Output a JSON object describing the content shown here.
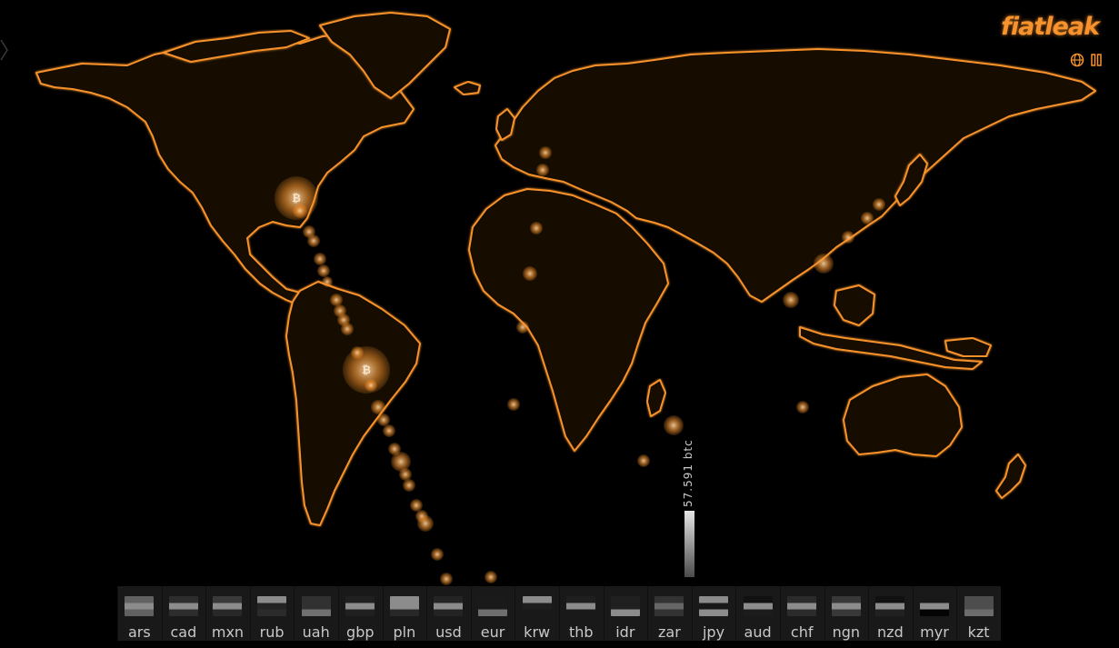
{
  "app": {
    "logo_text": "fiatleak"
  },
  "controls": {
    "globe_icon": "globe-icon",
    "pause_icon": "pause-icon"
  },
  "scale": {
    "value_label": "57.591 btc"
  },
  "currencies": [
    {
      "code": "ars",
      "flag": [
        "#8ab7dd",
        "#ffffff",
        "#8ab7dd"
      ]
    },
    {
      "code": "cad",
      "flag": [
        "#d32f2f",
        "#ffffff",
        "#d32f2f"
      ]
    },
    {
      "code": "mxn",
      "flag": [
        "#2e7d32",
        "#ffffff",
        "#c62828"
      ]
    },
    {
      "code": "rub",
      "flag": [
        "#ffffff",
        "#1e40a5",
        "#d52b1e"
      ]
    },
    {
      "code": "uah",
      "flag": [
        "#1f5fbf",
        "#1f5fbf",
        "#f2d600"
      ]
    },
    {
      "code": "gbp",
      "flag": [
        "#203a8f",
        "#ffffff",
        "#c8102e"
      ]
    },
    {
      "code": "pln",
      "flag": [
        "#ffffff",
        "#ffffff",
        "#d4213d"
      ]
    },
    {
      "code": "usd",
      "flag": [
        "#b22234",
        "#ffffff",
        "#3c3b6e"
      ]
    },
    {
      "code": "eur",
      "flag": [
        "#003399",
        "#003399",
        "#ffcc00"
      ]
    },
    {
      "code": "krw",
      "flag": [
        "#ffffff",
        "#c60c30",
        "#003478"
      ]
    },
    {
      "code": "thb",
      "flag": [
        "#a51931",
        "#ffffff",
        "#2d2a4a"
      ]
    },
    {
      "code": "idr",
      "flag": [
        "#ce1126",
        "#ce1126",
        "#ffffff"
      ]
    },
    {
      "code": "zar",
      "flag": [
        "#007a4d",
        "#ffb612",
        "#de3831"
      ]
    },
    {
      "code": "jpy",
      "flag": [
        "#ffffff",
        "#bc002d",
        "#ffffff"
      ]
    },
    {
      "code": "aud",
      "flag": [
        "#012169",
        "#ffffff",
        "#e4002b"
      ]
    },
    {
      "code": "chf",
      "flag": [
        "#d52b1e",
        "#ffffff",
        "#d52b1e"
      ]
    },
    {
      "code": "ngn",
      "flag": [
        "#008751",
        "#ffffff",
        "#008751"
      ]
    },
    {
      "code": "nzd",
      "flag": [
        "#012169",
        "#ffffff",
        "#cc142b"
      ]
    },
    {
      "code": "myr",
      "flag": [
        "#cc0001",
        "#ffffff",
        "#010066"
      ]
    },
    {
      "code": "kzt",
      "flag": [
        "#00afca",
        "#00afca",
        "#fec50c"
      ]
    }
  ],
  "colors": {
    "accent": "#f7922c",
    "land": "#140b02",
    "background": "#000000"
  }
}
